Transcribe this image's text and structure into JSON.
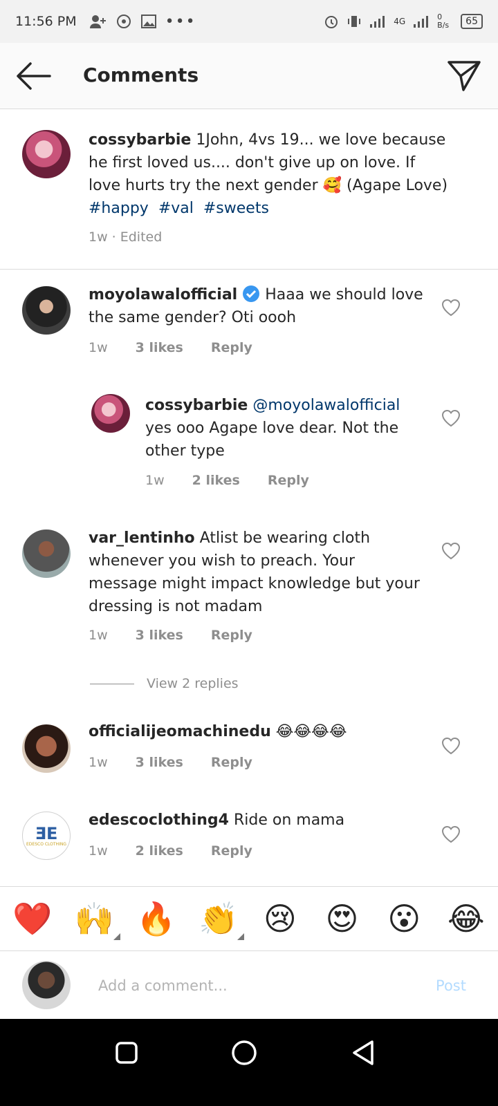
{
  "status_bar": {
    "time": "11:56 PM",
    "network": "4G",
    "data_rate": "0 B/s",
    "battery": "65"
  },
  "header": {
    "title": "Comments"
  },
  "caption": {
    "user": "cossybarbie",
    "text": " 1John, 4vs 19... we love because he first loved us.... don't give up on love.  If love hurts try the next gender 🥰 (Agape Love)",
    "tags": [
      "#happy",
      "#val",
      "#sweets"
    ],
    "meta": "1w · Edited"
  },
  "comments": [
    {
      "user": "moyolawalofficial",
      "verified": true,
      "text": " Haaa we should love the same gender?  Oti oooh",
      "time": "1w",
      "likes": "3 likes",
      "reply": "Reply"
    },
    {
      "user": "cossybarbie",
      "mention": " @moyolawalofficial",
      "text": " yes ooo Agape love dear.  Not the other type",
      "time": "1w",
      "likes": "2 likes",
      "reply": "Reply"
    },
    {
      "user": "var_lentinho",
      "text": " Atlist be wearing cloth whenever you wish to preach. Your message might impact knowledge but your dressing is not madam",
      "time": "1w",
      "likes": "3 likes",
      "reply": "Reply",
      "view_replies": "View 2 replies"
    },
    {
      "user": "officialijeomachinedu",
      "text": " 😂😂😂😂",
      "time": "1w",
      "likes": "3 likes",
      "reply": "Reply"
    },
    {
      "user": "edescoclothing4",
      "text": " Ride on mama",
      "time": "1w",
      "likes": "2 likes",
      "reply": "Reply",
      "logo_text": "EDESCO CLOTHING"
    }
  ],
  "emoji_bar": [
    "❤️",
    "🙌",
    "🔥",
    "👏",
    "😢",
    "😍",
    "😮",
    "😂"
  ],
  "composer": {
    "placeholder": "Add a comment...",
    "post_label": "Post"
  }
}
